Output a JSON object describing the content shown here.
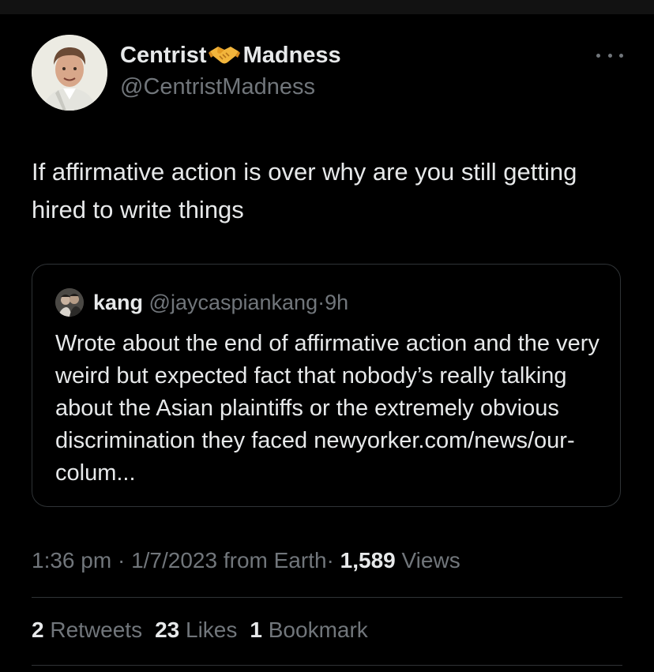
{
  "author": {
    "display_name_part1": "Centrist",
    "display_name_emoji": "handshake-icon",
    "display_name_part2": "Madness",
    "handle": "@CentristMadness"
  },
  "tweet": {
    "text": "If affirmative action is over why are you still getting hired to write things"
  },
  "quote": {
    "name": "kang",
    "handle": "@jaycaspiankang",
    "separator": "·",
    "time": "9h",
    "text": "Wrote about the end of affirmative action and the very weird but expected fact that nobody’s really talking about the Asian plaintiffs or the extremely obvious discrimination they faced newyorker.com/news/our-colum..."
  },
  "meta": {
    "time": "1:36 pm",
    "sep1": "·",
    "date": "1/7/2023",
    "source": "from Earth",
    "sep2": "·",
    "views_count": "1,589",
    "views_label": "Views"
  },
  "stats": {
    "retweets_count": "2",
    "retweets_label": "Retweets",
    "likes_count": "23",
    "likes_label": "Likes",
    "bookmarks_count": "1",
    "bookmarks_label": "Bookmark"
  },
  "colors": {
    "background": "#000000",
    "primary_text": "#e7e9ea",
    "secondary_text": "#71767b",
    "border": "#2f3336"
  }
}
